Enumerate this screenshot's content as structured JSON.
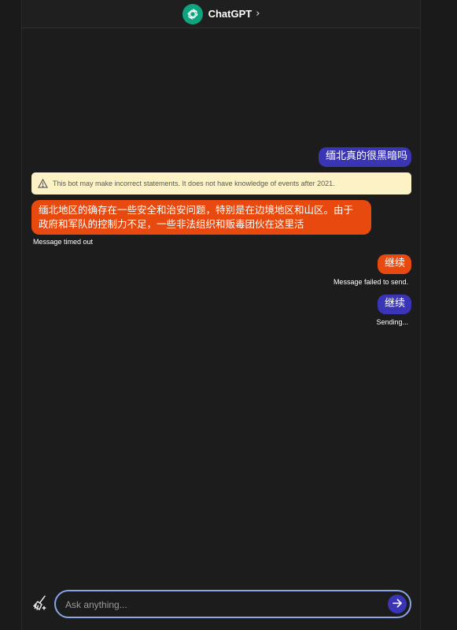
{
  "header": {
    "bot_name": "ChatGPT",
    "chevron": "›"
  },
  "messages": [
    {
      "role": "user",
      "text": "缅北真的很黑暗吗"
    },
    {
      "role": "warning",
      "text": "This bot may make incorrect statements. It does not have knowledge of events after 2021."
    },
    {
      "role": "bot",
      "line1": "缅北地区的确存在一些安全和治安问题，特别是在边境地区和山区。由于",
      "line2": "政府和军队的控制力不足，一些非法组织和贩毒团伙在这里活",
      "status": "Message timed out"
    },
    {
      "role": "user",
      "text": "继续",
      "status": "Message failed to send."
    },
    {
      "role": "user",
      "text": "继续",
      "status": "Sending..."
    }
  ],
  "composer": {
    "placeholder": "Ask anything..."
  },
  "colors": {
    "user_bubble": "#3a35b4",
    "failed_bubble": "#e8490f",
    "bot_bubble": "#e8490f",
    "warning_bg": "#fdf2c5",
    "input_border": "#8aa6e6",
    "brand": "#10a37f"
  },
  "icons": {
    "avatar": "openai-logo-icon",
    "warning": "warning-triangle-icon",
    "clear": "broom-icon",
    "send": "arrow-right-icon"
  }
}
